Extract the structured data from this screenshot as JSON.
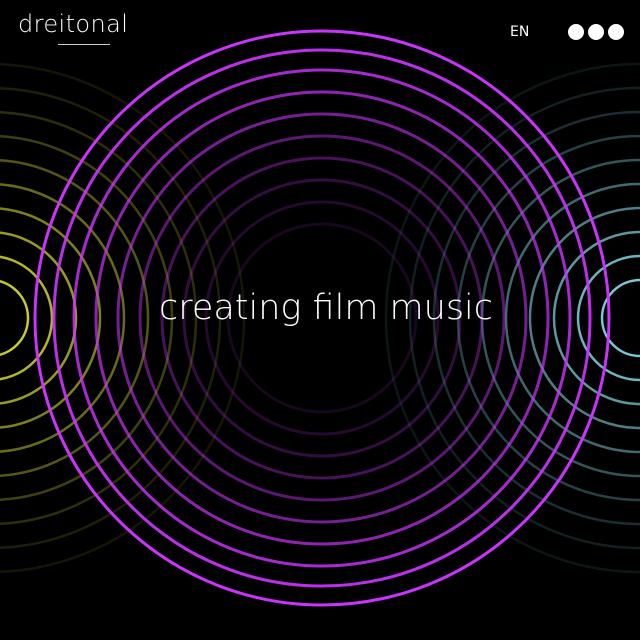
{
  "header": {
    "logo_text": "dreitonal",
    "language": "EN",
    "menu_icon": "three-dots-menu-icon"
  },
  "hero": {
    "tagline": "creating film music",
    "ring_colors": {
      "center": "#cc33ff",
      "left": "#d2d72a",
      "right": "#7fd3df"
    }
  }
}
